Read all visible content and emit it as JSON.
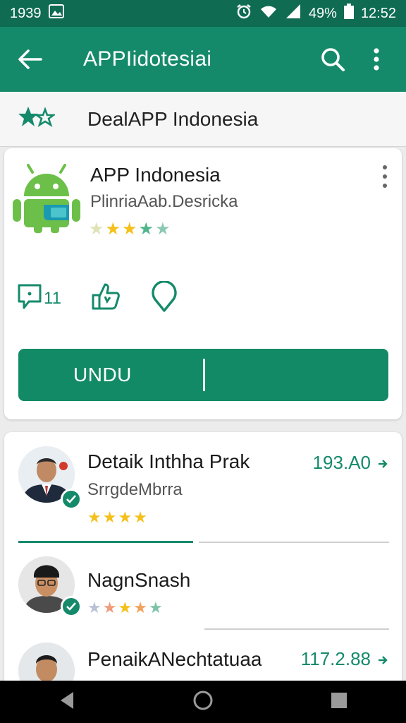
{
  "status_bar": {
    "left_text": "1939",
    "battery": "49%",
    "time": "12:52"
  },
  "app_bar": {
    "title": "APPIidotesiai",
    "icons": [
      "back-arrow-icon",
      "search-icon",
      "more-vert-icon"
    ]
  },
  "subheader": {
    "label": "DealAPP Indonesia",
    "icon": "stars-icon"
  },
  "app_card": {
    "name": "APP Indonesia",
    "subtitle": "PlinriaAab.Desricka",
    "rating_stars": 5,
    "actions": [
      {
        "icon": "comment-icon",
        "count": "11"
      },
      {
        "icon": "thumbs-up-icon",
        "count": ""
      },
      {
        "icon": "location-pin-icon",
        "count": ""
      }
    ],
    "primary_button": "UNDU"
  },
  "list": [
    {
      "title": "Detaik Inthha Prak",
      "subtitle": "SrrgdeMbrra",
      "stars": 4,
      "value": "193.A0",
      "verified": true
    },
    {
      "title": "NagnSnash",
      "subtitle": "",
      "stars": 5,
      "value": "",
      "verified": true
    },
    {
      "title": "PenaikANechtatuaa",
      "subtitle": "",
      "stars": 0,
      "value": "117.2.88",
      "verified": false
    }
  ],
  "colors": {
    "status_bar": "#0f6b52",
    "app_bar": "#158a6b",
    "accent": "#138a66",
    "star_gold": "#f4c019",
    "star_green": "#4fb58a"
  },
  "nav": [
    "back-triangle-icon",
    "home-circle-icon",
    "recents-square-icon"
  ]
}
